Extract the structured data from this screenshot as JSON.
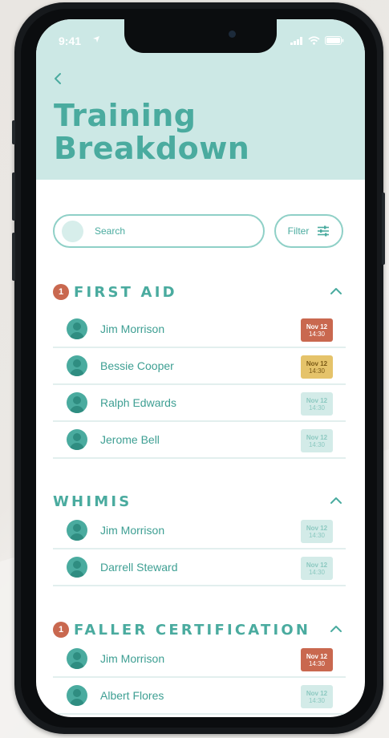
{
  "status_bar": {
    "time": "9:41"
  },
  "page": {
    "title_line1": "Training",
    "title_line2": "Breakdown"
  },
  "search": {
    "placeholder": "Search"
  },
  "filter": {
    "label": "Filter"
  },
  "colors": {
    "accent": "#4aab9f",
    "header_bg": "#cce8e5",
    "overdue": "#c9684f",
    "warning": "#e5c36a",
    "upcoming": "#d3ebe8"
  },
  "sections": [
    {
      "title": "FIRST AID",
      "badge": "1",
      "expanded": true,
      "rows": [
        {
          "name": "Jim Morrison",
          "date": "Nov 12",
          "time": "14:30",
          "status": "overdue"
        },
        {
          "name": "Bessie Cooper",
          "date": "Nov 12",
          "time": "14:30",
          "status": "warning"
        },
        {
          "name": "Ralph Edwards",
          "date": "Nov 12",
          "time": "14:30",
          "status": "upcoming"
        },
        {
          "name": "Jerome Bell",
          "date": "Nov 12",
          "time": "14:30",
          "status": "upcoming"
        }
      ]
    },
    {
      "title": "WHIMIS",
      "badge": "",
      "expanded": true,
      "rows": [
        {
          "name": "Jim Morrison",
          "date": "Nov 12",
          "time": "14:30",
          "status": "upcoming"
        },
        {
          "name": "Darrell Steward",
          "date": "Nov 12",
          "time": "14:30",
          "status": "upcoming"
        }
      ]
    },
    {
      "title": "FALLER CERTIFICATION",
      "badge": "1",
      "expanded": true,
      "rows": [
        {
          "name": "Jim Morrison",
          "date": "Nov 12",
          "time": "14:30",
          "status": "overdue"
        },
        {
          "name": "Albert Flores",
          "date": "Nov 12",
          "time": "14:30",
          "status": "upcoming"
        }
      ]
    }
  ],
  "icons": {
    "back": "chevron-left-icon",
    "filter": "sliders-icon",
    "collapse": "chevron-up-icon",
    "avatar": "user-icon",
    "signal": "signal-icon",
    "wifi": "wifi-icon",
    "battery": "battery-icon",
    "location": "location-arrow-icon"
  }
}
